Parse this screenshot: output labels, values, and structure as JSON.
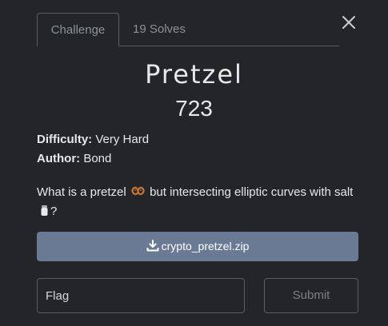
{
  "tabs": [
    {
      "label": "Challenge",
      "active": true
    },
    {
      "label": "19 Solves",
      "active": false
    }
  ],
  "challenge": {
    "name": "Pretzel",
    "points": "723",
    "difficulty_label": "Difficulty:",
    "difficulty_value": "Very Hard",
    "author_label": "Author:",
    "author_value": "Bond",
    "description_part1": "What is a pretzel",
    "description_part2": "but intersecting elliptic curves with salt",
    "description_part3": "?"
  },
  "download": {
    "filename": "crypto_pretzel.zip",
    "icon": "download-icon"
  },
  "flag": {
    "placeholder": "Flag",
    "value": ""
  },
  "submit_label": "Submit",
  "icons": {
    "close": "close-icon",
    "pretzel": "pretzel-emoji",
    "salt": "salt-emoji"
  },
  "colors": {
    "background": "#232529",
    "download_button": "#6b7a94",
    "border": "#5a5d63",
    "muted_text": "#8d9198"
  }
}
